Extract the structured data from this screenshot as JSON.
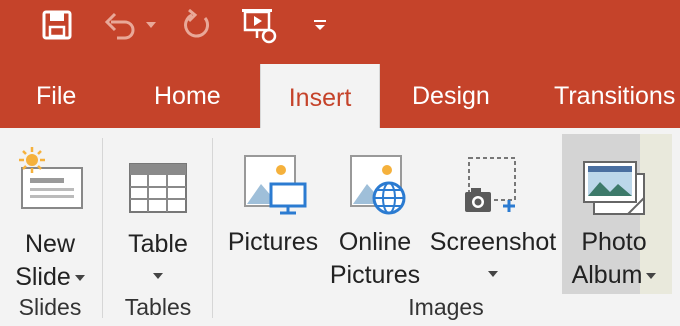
{
  "quick_access": {
    "items": [
      "save-icon",
      "undo-icon",
      "undo-dropdown-icon",
      "redo-icon",
      "presentation-icon",
      "customize-toolbar-icon"
    ]
  },
  "tabs": [
    "File",
    "Home",
    "Insert",
    "Design",
    "Transitions"
  ],
  "active_tab": "Insert",
  "ribbon": {
    "new_slide": {
      "line1": "New",
      "line2": "Slide"
    },
    "table": {
      "label": "Table"
    },
    "pictures": {
      "label": "Pictures"
    },
    "online_pictures": {
      "line1": "Online",
      "line2": "Pictures"
    },
    "screenshot": {
      "label": "Screenshot"
    },
    "photo_album": {
      "line1": "Photo",
      "line2": "Album"
    },
    "groups": {
      "slides": "Slides",
      "tables": "Tables",
      "images": "Images"
    }
  },
  "colors": {
    "title_bar": "#c5432a",
    "ribbon_bg": "#f3f3f3",
    "active_tab_text": "#c5432a",
    "icon_blue": "#2b7bd1"
  }
}
